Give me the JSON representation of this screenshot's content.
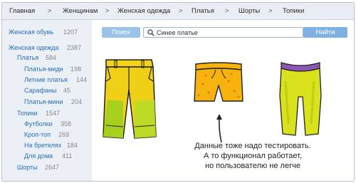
{
  "breadcrumb": {
    "items": [
      "Главная",
      "Женщинам",
      "Женская одежда",
      "Платья",
      "Шорты",
      "Топики"
    ],
    "separator": ">"
  },
  "sidebar": {
    "items": [
      {
        "label": "Женская обувь",
        "count": "1207"
      },
      {
        "label": "Женская одежда",
        "count": "2387"
      },
      {
        "label": "Платья",
        "count": "584"
      },
      {
        "label": "Платья-миди",
        "count": "198"
      },
      {
        "label": "Летние платья",
        "count": "144"
      },
      {
        "label": "Сарафаны",
        "count": "45"
      },
      {
        "label": "Платья-мини",
        "count": "204"
      },
      {
        "label": "Топики",
        "count": "1547"
      },
      {
        "label": "Футболки",
        "count": "358"
      },
      {
        "label": "Кроп-топ",
        "count": "269"
      },
      {
        "label": "На бретелях",
        "count": "184"
      },
      {
        "label": "Для дома",
        "count": "411"
      },
      {
        "label": "Шорты",
        "count": "2647"
      }
    ]
  },
  "search": {
    "left_button": "Поиск",
    "value": "Синее платье",
    "submit_button": "Найти"
  },
  "products": [
    {
      "icon": "yellow-green-shorts-icon"
    },
    {
      "icon": "orange-short-shorts-icon"
    },
    {
      "icon": "yellow-leggings-shorts-icon"
    }
  ],
  "note": {
    "line1": "Данные тоже надо тестировать.",
    "line2": "А то функционал работает,",
    "line3": "но пользователю не легче"
  },
  "colors": {
    "breadcrumb_bg": "#e9eef4",
    "sidebar_bg": "#eaf0f6",
    "link": "#2a6db5",
    "button": "#7fb0e2"
  }
}
